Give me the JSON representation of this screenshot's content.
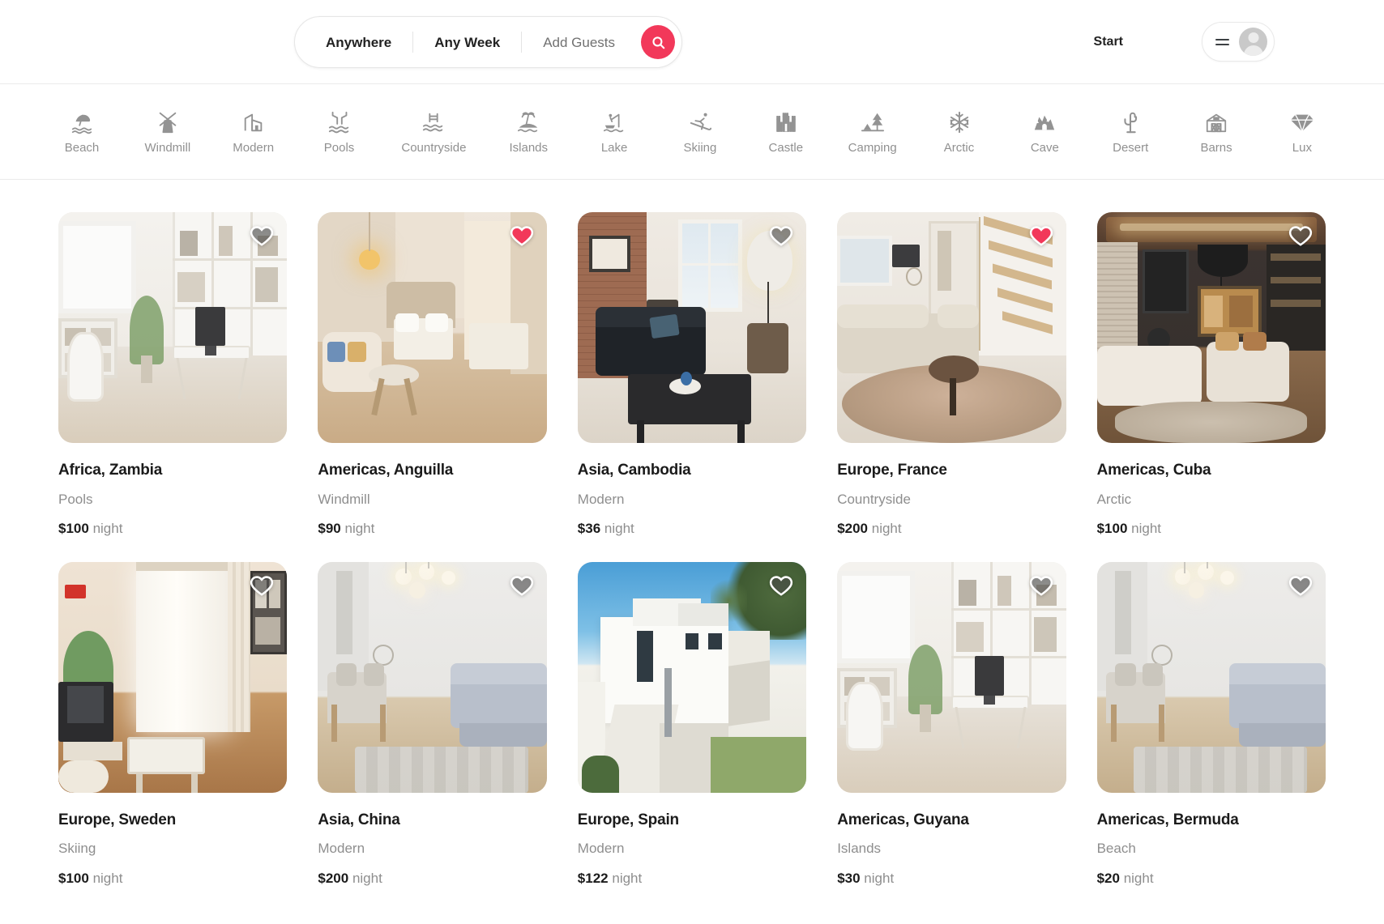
{
  "header": {
    "search": {
      "location_label": "Anywhere",
      "dates_label": "Any Week",
      "guests_label": "Add Guests",
      "search_icon": "search-icon"
    },
    "start_label": "Start",
    "menu_icon": "hamburger-icon",
    "avatar_icon": "user-avatar-icon"
  },
  "categories": [
    {
      "label": "Beach",
      "icon": "beach-umbrella-icon"
    },
    {
      "label": "Windmill",
      "icon": "windmill-icon"
    },
    {
      "label": "Modern",
      "icon": "modern-building-icon"
    },
    {
      "label": "Pools",
      "icon": "pool-icon"
    },
    {
      "label": "Countryside",
      "icon": "countryside-icon"
    },
    {
      "label": "Islands",
      "icon": "island-palm-icon"
    },
    {
      "label": "Lake",
      "icon": "lake-fishing-icon"
    },
    {
      "label": "Skiing",
      "icon": "skiing-icon"
    },
    {
      "label": "Castle",
      "icon": "castle-icon"
    },
    {
      "label": "Camping",
      "icon": "camping-tent-icon"
    },
    {
      "label": "Arctic",
      "icon": "snowflake-icon"
    },
    {
      "label": "Cave",
      "icon": "cave-icon"
    },
    {
      "label": "Desert",
      "icon": "cactus-icon"
    },
    {
      "label": "Barns",
      "icon": "barn-icon"
    },
    {
      "label": "Lux",
      "icon": "diamond-icon"
    }
  ],
  "colors": {
    "accent": "#f2385a",
    "title": "#1b1b1b",
    "muted": "#8e8e8e",
    "border": "#ebebeb"
  },
  "listings": [
    {
      "title": "Africa, Zambia",
      "category": "Pools",
      "price": "$100",
      "price_unit": "night",
      "favorited": false,
      "scene": "office-shelf"
    },
    {
      "title": "Americas, Anguilla",
      "category": "Windmill",
      "price": "$90",
      "price_unit": "night",
      "favorited": true,
      "scene": "bedroom-warm"
    },
    {
      "title": "Asia, Cambodia",
      "category": "Modern",
      "price": "$36",
      "price_unit": "night",
      "favorited": false,
      "scene": "loft-brick"
    },
    {
      "title": "Europe, France",
      "category": "Countryside",
      "price": "$200",
      "price_unit": "night",
      "favorited": true,
      "scene": "stairs-lounge"
    },
    {
      "title": "Americas, Cuba",
      "category": "Arctic",
      "price": "$100",
      "price_unit": "night",
      "favorited": false,
      "scene": "dark-living"
    },
    {
      "title": "Europe, Sweden",
      "category": "Skiing",
      "price": "$100",
      "price_unit": "night",
      "favorited": false,
      "scene": "curtain-tv"
    },
    {
      "title": "Asia, China",
      "category": "Modern",
      "price": "$200",
      "price_unit": "night",
      "favorited": false,
      "scene": "dining-sofa"
    },
    {
      "title": "Europe, Spain",
      "category": "Modern",
      "price": "$122",
      "price_unit": "night",
      "favorited": false,
      "scene": "white-villa"
    },
    {
      "title": "Americas, Guyana",
      "category": "Islands",
      "price": "$30",
      "price_unit": "night",
      "favorited": false,
      "scene": "office-shelf"
    },
    {
      "title": "Americas, Bermuda",
      "category": "Beach",
      "price": "$20",
      "price_unit": "night",
      "favorited": false,
      "scene": "dining-sofa"
    }
  ]
}
